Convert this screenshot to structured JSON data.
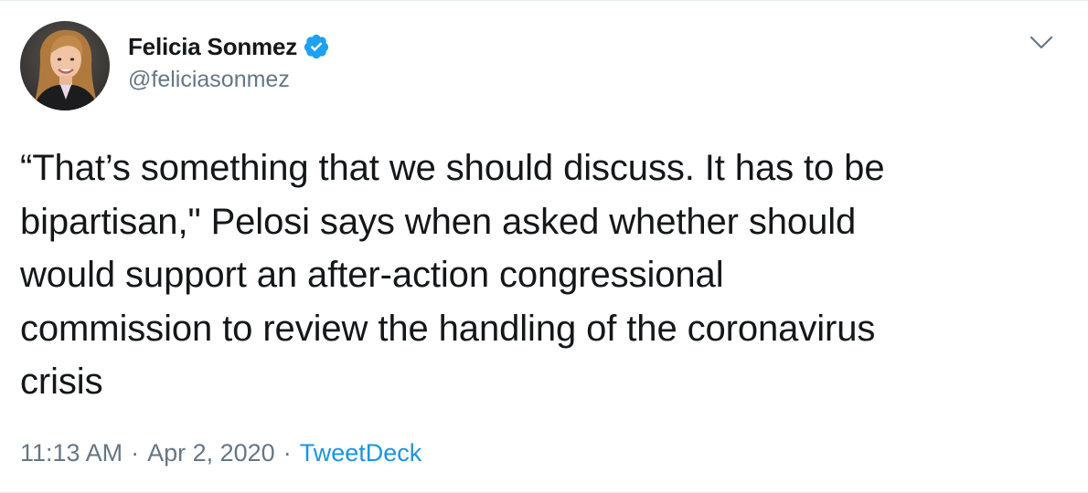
{
  "author": {
    "name": "Felicia Sonmez",
    "handle": "@feliciasonmez",
    "verified": true,
    "avatar_icon": "profile-photo"
  },
  "tweet": {
    "text": "“That’s something that we should discuss. It has to be\nbipartisan,\" Pelosi says when asked whether should\nwould support an after-action congressional\ncommission to review the handling of the coronavirus\ncrisis"
  },
  "meta": {
    "time": "11:13 AM",
    "separator": "·",
    "date": "Apr 2, 2020",
    "source": "TweetDeck"
  },
  "icons": {
    "verified": "verified-badge-icon",
    "more": "chevron-down-icon"
  },
  "colors": {
    "text": "#14171a",
    "secondary": "#657786",
    "link": "#1b95e0",
    "verified": "#1da1f2"
  }
}
